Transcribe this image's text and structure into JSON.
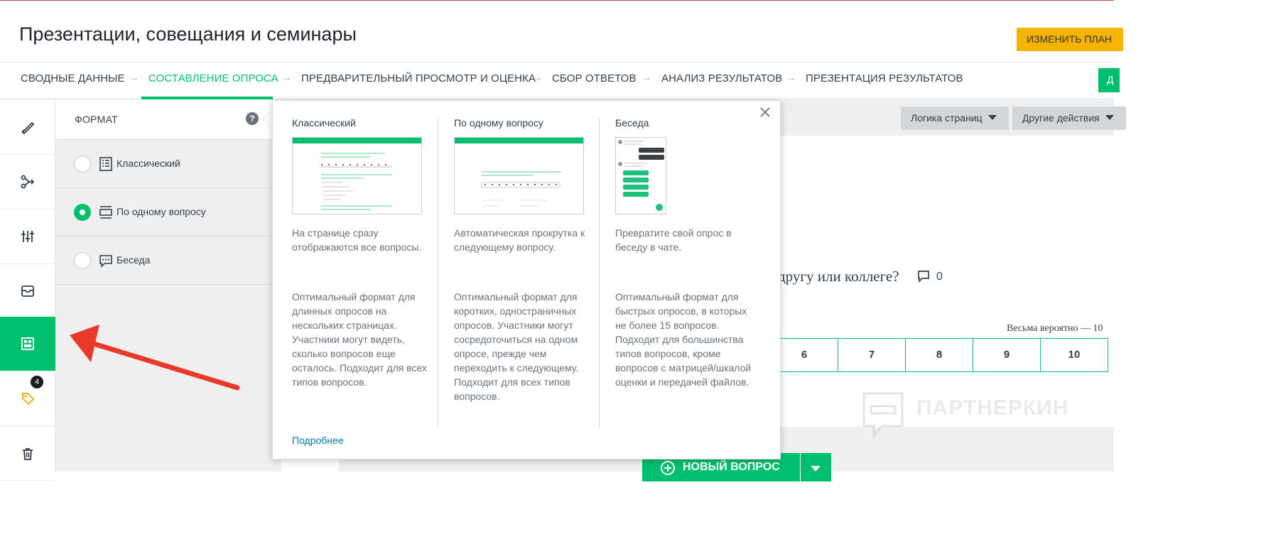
{
  "page": {
    "title": "Презентации, совещания и семинары",
    "upgrade_button": "ИЗМЕНИТЬ ПЛАН",
    "design_button": "Д"
  },
  "steps": [
    {
      "label": "СВОДНЫЕ ДАННЫЕ",
      "active": false
    },
    {
      "label": "СОСТАВЛЕНИЕ ОПРОСА",
      "active": true
    },
    {
      "label": "ПРЕДВАРИТЕЛЬНЫЙ ПРОСМОТР И ОЦЕНКА",
      "active": false
    },
    {
      "label": "СБОР ОТВЕТОВ",
      "active": false
    },
    {
      "label": "АНАЛИЗ РЕЗУЛЬТАТОВ",
      "active": false
    },
    {
      "label": "ПРЕЗЕНТАЦИЯ РЕЗУЛЬТАТОВ",
      "active": false
    }
  ],
  "step_arrow": "→",
  "left_rail": {
    "items": [
      {
        "icon": "brush-icon"
      },
      {
        "icon": "logic-icon"
      },
      {
        "icon": "options-icon"
      },
      {
        "icon": "bank-icon"
      },
      {
        "icon": "format-icon",
        "active": true
      },
      {
        "icon": "tag-icon",
        "badge": "4"
      },
      {
        "icon": "trash-icon"
      }
    ],
    "badge_count": "4"
  },
  "format_panel": {
    "title": "ФОРМАТ",
    "help": "?",
    "options": [
      {
        "label": "Классический",
        "checked": false,
        "icon": "classic-list-icon"
      },
      {
        "label": "По одному вопросу",
        "checked": true,
        "icon": "one-question-icon"
      },
      {
        "label": "Беседа",
        "checked": false,
        "icon": "chat-icon"
      }
    ]
  },
  "toolbar": {
    "page_logic": "Логика страниц",
    "more_actions": "Другие действия"
  },
  "question": {
    "text": "другу или коллеге?",
    "comment_count": "0",
    "scale_label": "Весьма вероятно — 10",
    "scale_values": [
      "6",
      "7",
      "8",
      "9",
      "10"
    ]
  },
  "watermark": "ПАРТНЕРКИН",
  "new_question_button": "НОВЫЙ ВОПРОС",
  "popover": {
    "close": "×",
    "columns": [
      {
        "title": "Классический",
        "desc": "На странице сразу отображаются все вопросы.",
        "details": "Оптимальный формат для длинных опросов на нескольких страницах. Участники могут видеть, сколько вопросов еще осталось. Подходит для всех типов вопросов."
      },
      {
        "title": "По одному вопросу",
        "desc": "Автоматическая прокрутка к следующему вопросу.",
        "details": "Оптимальный формат для коротких, одностраничных опросов. Участники могут сосредоточиться на одном опросе, прежде чем переходить к следующему. Подходит для всех типов вопросов."
      },
      {
        "title": "Беседа",
        "desc": "Превратите свой опрос в беседу в чате.",
        "details": "Оптимальный формат для быстрых опросов, в которых не более 15 вопросов. Подходит для большинства типов вопросов, кроме вопросов с матрицей/шкалой оценки и передачей файлов."
      }
    ],
    "more_link": "Подробнее"
  },
  "colors": {
    "accent": "#00bf6f",
    "upgrade": "#f5b400",
    "annotation_arrow": "#e8392b"
  }
}
